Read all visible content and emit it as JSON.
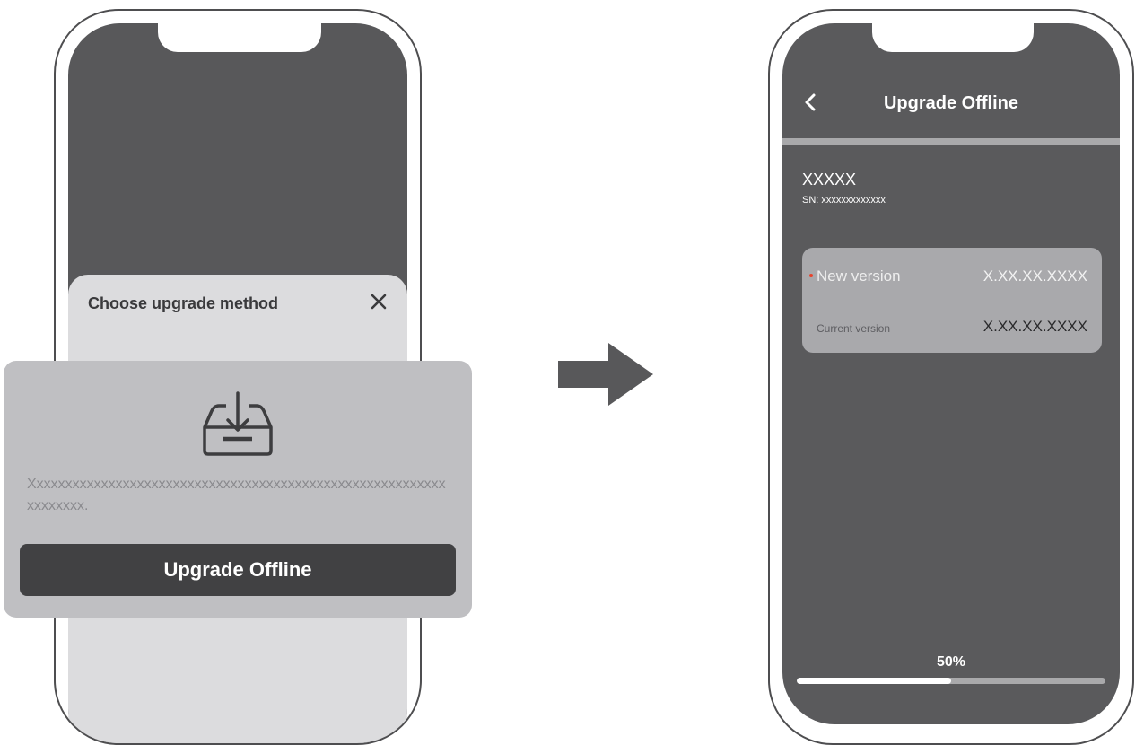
{
  "left_phone": {
    "sheet_title": "Choose upgrade method",
    "close_icon": "close-icon"
  },
  "method_card": {
    "icon": "download-box-icon",
    "description": "Xxxxxxxxxxxxxxxxxxxxxxxxxxxxxxxxxxxxxxxxxxxxxxxxxxxxxxxxxxxxxxxxxx.",
    "button_label": "Upgrade Offline"
  },
  "transition_arrow": "arrow-right-icon",
  "right_phone": {
    "back_icon": "chevron-left-icon",
    "title": "Upgrade Offline",
    "device_name": "XXXXX",
    "serial": "SN: xxxxxxxxxxxxx",
    "new_version_label": "New version",
    "new_version_value": "X.XX.XX.XXXX",
    "current_version_label": "Current version",
    "current_version_value": "X.XX.XX.XXXX",
    "progress_text": "50%",
    "progress_fraction": 0.5
  },
  "colors": {
    "screen_dark": "#58585a",
    "sheet_light": "#dcdcde",
    "card_gray": "#bfbfc2",
    "button_dark": "#414143",
    "accent_dot": "#e8432c",
    "progress_track": "#a9a9ab",
    "progress_fill": "#ffffff"
  }
}
